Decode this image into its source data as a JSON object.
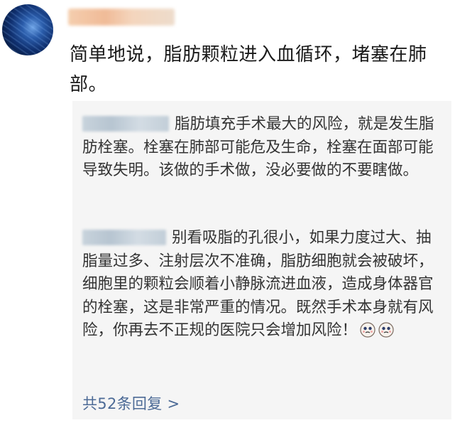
{
  "post": {
    "text": "简单地说，脂肪颗粒进入血循环，堵塞在肺部。"
  },
  "replies": [
    {
      "text": "脂肪填充手术最大的风险，就是发生脂肪栓塞。栓塞在肺部可能危及生命，栓塞在面部可能导致失明。该做的手术做，没必要做的不要瞎做。"
    },
    {
      "text": "别看吸脂的孔很小，如果力度过大、抽脂量过多、注射层次不准确，脂肪细胞就会被破坏，细胞里的颗粒会顺着小静脉流进血液，造成身体器官的栓塞，这是非常严重的情况。既然手术本身就有风险，你再去不正规的医院只会增加风险！"
    }
  ],
  "more_replies": "共52条回复 >",
  "colors": {
    "link": "#4c6a96",
    "reply_bg": "#f5f5f5"
  }
}
